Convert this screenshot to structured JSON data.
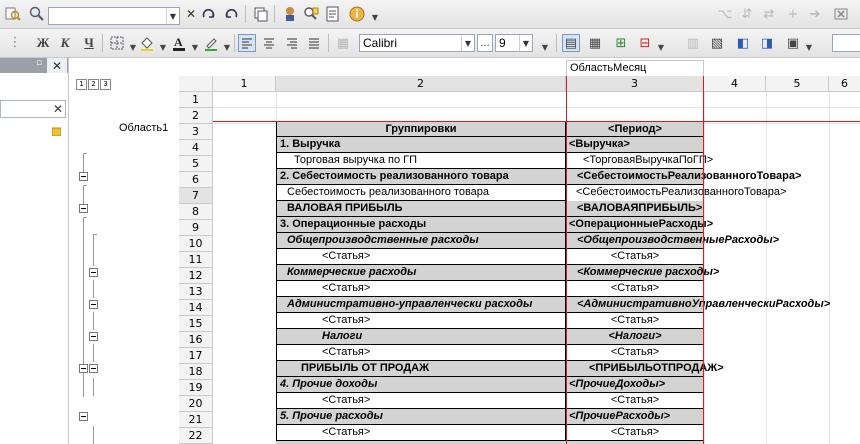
{
  "toolbar1": {
    "search_value": "",
    "icons": [
      "find-icon",
      "search-icon",
      "find-next-icon",
      "find-prev-icon",
      "copy-icon",
      "wizard-icon",
      "search-module-icon",
      "syntax-helper-icon",
      "info-icon"
    ]
  },
  "toolbar2": {
    "format_labels": {
      "bold": "Ж",
      "italic": "К",
      "underline": "Ч"
    },
    "font_name": "Calibri",
    "font_more": "...",
    "font_size": "9"
  },
  "grouping_levels": [
    "1",
    "2",
    "3"
  ],
  "area_label": "Область1",
  "column_area_label": "ОбластьМесяц",
  "columns": [
    "1",
    "2",
    "3",
    "4",
    "5",
    "6"
  ],
  "rows": [
    {
      "n": "1",
      "a": "",
      "b": ""
    },
    {
      "n": "2",
      "a": "",
      "b": ""
    },
    {
      "n": "3",
      "a": "Группировки",
      "b": "<Период>"
    },
    {
      "n": "4",
      "a": "1. Выручка",
      "b": "<Выручка>"
    },
    {
      "n": "5",
      "a": "Торговая выручка по ГП",
      "b": "<ТорговаяВыручкаПоГП>"
    },
    {
      "n": "6",
      "a": "2. Себестоимость реализованного товара",
      "b": "<СебестоимостьРеализованногоТовара>"
    },
    {
      "n": "7",
      "a": "Себестоимость реализованного товара",
      "b": "<СебестоимостьРеализованногоТовара>"
    },
    {
      "n": "8",
      "a": "ВАЛОВАЯ ПРИБЫЛЬ",
      "b": "<ВАЛОВАЯПРИБЫЛЬ>"
    },
    {
      "n": "9",
      "a": "3. Операционные расходы",
      "b": "<ОперационныеРасходы>"
    },
    {
      "n": "10",
      "a": "Общепроизводственные расходы",
      "b": "<ОбщепроизводственныеРасходы>"
    },
    {
      "n": "11",
      "a": "<Статья>",
      "b": "<Статья>"
    },
    {
      "n": "12",
      "a": "Коммерческие расходы",
      "b": "<Коммерческие расходы>"
    },
    {
      "n": "13",
      "a": "<Статья>",
      "b": "<Статья>"
    },
    {
      "n": "14",
      "a": "Административно-управленчески расходы",
      "b": "<АдминистративноУправленческиРасходы>"
    },
    {
      "n": "15",
      "a": "<Статья>",
      "b": "<Статья>"
    },
    {
      "n": "16",
      "a": "Налоги",
      "b": "<Налоги>"
    },
    {
      "n": "17",
      "a": "<Статья>",
      "b": "<Статья>"
    },
    {
      "n": "18",
      "a": "ПРИБЫЛЬ ОТ ПРОДАЖ",
      "b": "<ПРИБЫЛЬОТПРОДАЖ>"
    },
    {
      "n": "19",
      "a": "4. Прочие доходы",
      "b": "<ПрочиеДоходы>"
    },
    {
      "n": "20",
      "a": "<Статья>",
      "b": "<Статья>"
    },
    {
      "n": "21",
      "a": "5. Прочие расходы",
      "b": "<ПрочиеРасходы>"
    },
    {
      "n": "22",
      "a": "<Статья>",
      "b": "<Статья>"
    }
  ],
  "colors": {
    "selection_border": "#cc2222",
    "header_gray": "#d3d3d3",
    "accent_blue": "#2a5db0"
  }
}
